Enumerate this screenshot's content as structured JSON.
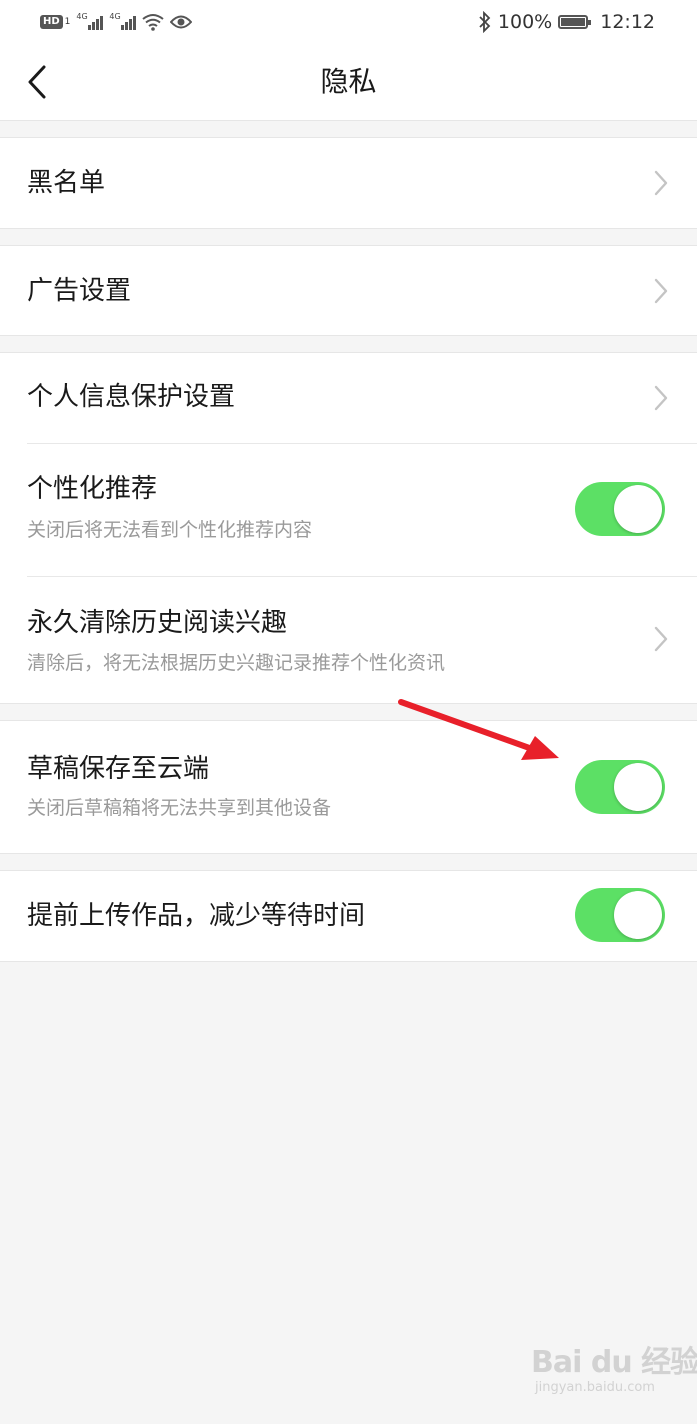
{
  "status_bar": {
    "hd_label": "HD",
    "sim_number": "1",
    "network1": "4G",
    "network2": "4G",
    "battery_percent": "100%",
    "time": "12:12"
  },
  "header": {
    "title": "隐私"
  },
  "settings": {
    "blacklist": {
      "title": "黑名单"
    },
    "ad_settings": {
      "title": "广告设置"
    },
    "personal_info": {
      "title": "个人信息保护设置"
    },
    "personalized": {
      "title": "个性化推荐",
      "subtitle": "关闭后将无法看到个性化推荐内容",
      "enabled": true
    },
    "clear_history": {
      "title": "永久清除历史阅读兴趣",
      "subtitle": "清除后，将无法根据历史兴趣记录推荐个性化资讯"
    },
    "draft_cloud": {
      "title": "草稿保存至云端",
      "subtitle": "关闭后草稿箱将无法共享到其他设备",
      "enabled": true
    },
    "pre_upload": {
      "title": "提前上传作品，减少等待时间",
      "enabled": true
    }
  },
  "colors": {
    "toggle_on": "#5ce065",
    "annotation_arrow": "#e8202a",
    "background": "#f5f5f5"
  },
  "watermark": {
    "main": "Bai du 经验",
    "sub": "jingyan.baidu.com"
  }
}
